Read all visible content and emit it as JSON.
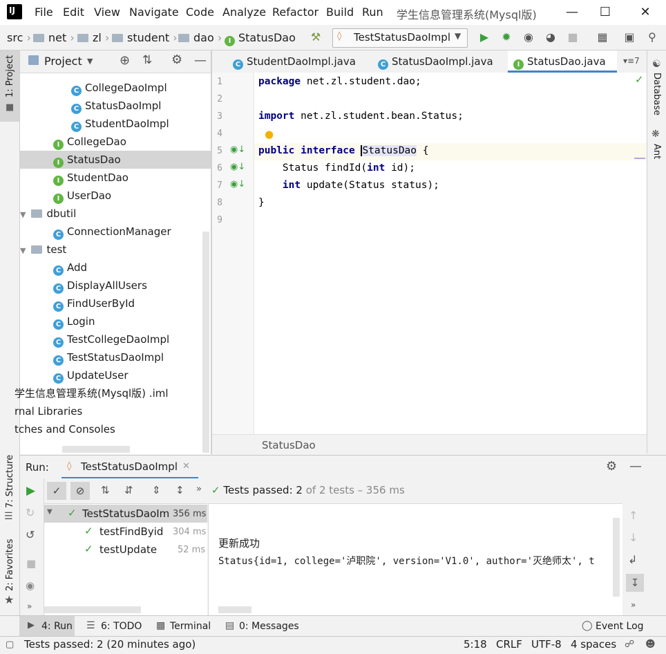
{
  "menubar": {
    "items": [
      "File",
      "Edit",
      "View",
      "Navigate",
      "Code",
      "Analyze",
      "Refactor",
      "Build",
      "Run"
    ],
    "window_title": "学生信息管理系统(Mysql版)"
  },
  "navbar": {
    "crumbs": [
      "src",
      "net",
      "zl",
      "student",
      "dao",
      "StatusDao"
    ],
    "run_config": "TestStatusDaoImpl"
  },
  "left_strip": {
    "project_label": "1: Project",
    "structure_label": "7: Structure",
    "favorites_label": "2: Favorites"
  },
  "right_strip": {
    "database_label": "Database",
    "ant_label": "Ant"
  },
  "project": {
    "title": "Project",
    "tree": [
      {
        "label": "CollegeDaoImpl",
        "kind": "class"
      },
      {
        "label": "StatusDaoImpl",
        "kind": "class"
      },
      {
        "label": "StudentDaoImpl",
        "kind": "class"
      },
      {
        "label": "CollegeDao",
        "kind": "interface"
      },
      {
        "label": "StatusDao",
        "kind": "interface"
      },
      {
        "label": "StudentDao",
        "kind": "interface"
      },
      {
        "label": "UserDao",
        "kind": "interface"
      },
      {
        "label": "dbutil",
        "kind": "folder"
      },
      {
        "label": "ConnectionManager",
        "kind": "class"
      },
      {
        "label": "test",
        "kind": "folder"
      },
      {
        "label": "Add",
        "kind": "runnable"
      },
      {
        "label": "DisplayAllUsers",
        "kind": "runnable"
      },
      {
        "label": "FindUserById",
        "kind": "runnable"
      },
      {
        "label": "Login",
        "kind": "runnable"
      },
      {
        "label": "TestCollegeDaoImpl",
        "kind": "runnable"
      },
      {
        "label": "TestStatusDaoImpl",
        "kind": "runnable"
      },
      {
        "label": "UpdateUser",
        "kind": "runnable"
      },
      {
        "label": "学生信息管理系统(Mysql版) .iml",
        "kind": "file"
      },
      {
        "label": "rnal Libraries",
        "kind": "lib"
      },
      {
        "label": "tches and Consoles",
        "kind": "lib"
      }
    ]
  },
  "editor": {
    "tabs": [
      "StudentDaoImpl.java",
      "StatusDaoImpl.java",
      "StatusDao.java"
    ],
    "tab_overflow": "7",
    "line_numbers": [
      "1",
      "2",
      "3",
      "4",
      "5",
      "6",
      "7",
      "8",
      "9"
    ],
    "lines": {
      "l1_kw": "package",
      "l1_rest": " net.zl.student.dao;",
      "l3_kw": "import",
      "l3_rest": " net.zl.student.bean.Status;",
      "l5_kw1": "public",
      "l5_kw2": "interface",
      "l5_name": "StatusDao",
      "l5_rest": " {",
      "l6_a": "    Status findId(",
      "l6_kw": "int",
      "l6_b": " id);",
      "l7_kw": "int",
      "l7_rest": " update(Status status);",
      "l8": "}"
    },
    "breadcrumb": "StatusDao"
  },
  "run_panel": {
    "label": "Run:",
    "tab": "TestStatusDaoImpl",
    "summary_bold": "Tests passed: 2",
    "summary_rest": "of 2 tests – 356 ms",
    "tests": [
      {
        "name": "TestStatusDaoIm",
        "time": "356 ms"
      },
      {
        "name": "testFindByid",
        "time": "304 ms"
      },
      {
        "name": "testUpdate",
        "time": "52 ms"
      }
    ],
    "console_lines": [
      "更新成功",
      "Status{id=1, college='泸职院', version='V1.0', author='灭绝师太', t"
    ]
  },
  "tool_strip": {
    "run": "4: Run",
    "todo": "6: TODO",
    "terminal": "Terminal",
    "messages": "0: Messages",
    "event_log": "Event Log"
  },
  "status_bar": {
    "message": "Tests passed: 2 (20 minutes ago)",
    "position": "5:18",
    "line_sep": "CRLF",
    "encoding": "UTF-8",
    "indent": "4 spaces"
  },
  "colors": {
    "accent": "#4083c9",
    "keyword": "#000080",
    "pass_green": "#3aa03a",
    "class_icon": "#3f9fd8",
    "interface_icon": "#62b543"
  }
}
